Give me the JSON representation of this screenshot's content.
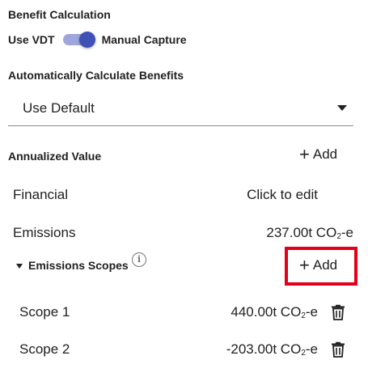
{
  "benefit": {
    "title": "Benefit Calculation",
    "toggle_left_label": "Use VDT",
    "toggle_right_label": "Manual Capture",
    "toggle_state": "right",
    "accent_color": "#3f51b5"
  },
  "auto_calc": {
    "label": "Automatically Calculate Benefits",
    "selected": "Use Default"
  },
  "annualized": {
    "title": "Annualized Value",
    "add_label": "Add"
  },
  "rows": {
    "financial_label": "Financial",
    "financial_value": "Click to edit",
    "emissions_label": "Emissions",
    "emissions_value_num": "237.00t CO",
    "emissions_value_sub": "2",
    "emissions_value_unit": "-e"
  },
  "scopes": {
    "title": "Emissions Scopes",
    "add_label": "Add",
    "items": [
      {
        "label": "Scope 1",
        "value_num": "440.00t CO",
        "value_sub": "2",
        "value_unit": "-e"
      },
      {
        "label": "Scope 2",
        "value_num": "-203.00t CO",
        "value_sub": "2",
        "value_unit": "-e"
      }
    ]
  },
  "icons": {
    "info": "info-icon",
    "trash": "trash-icon",
    "plus": "plus-icon",
    "caret": "caret-down-icon"
  },
  "highlight_color": "#e2001a"
}
